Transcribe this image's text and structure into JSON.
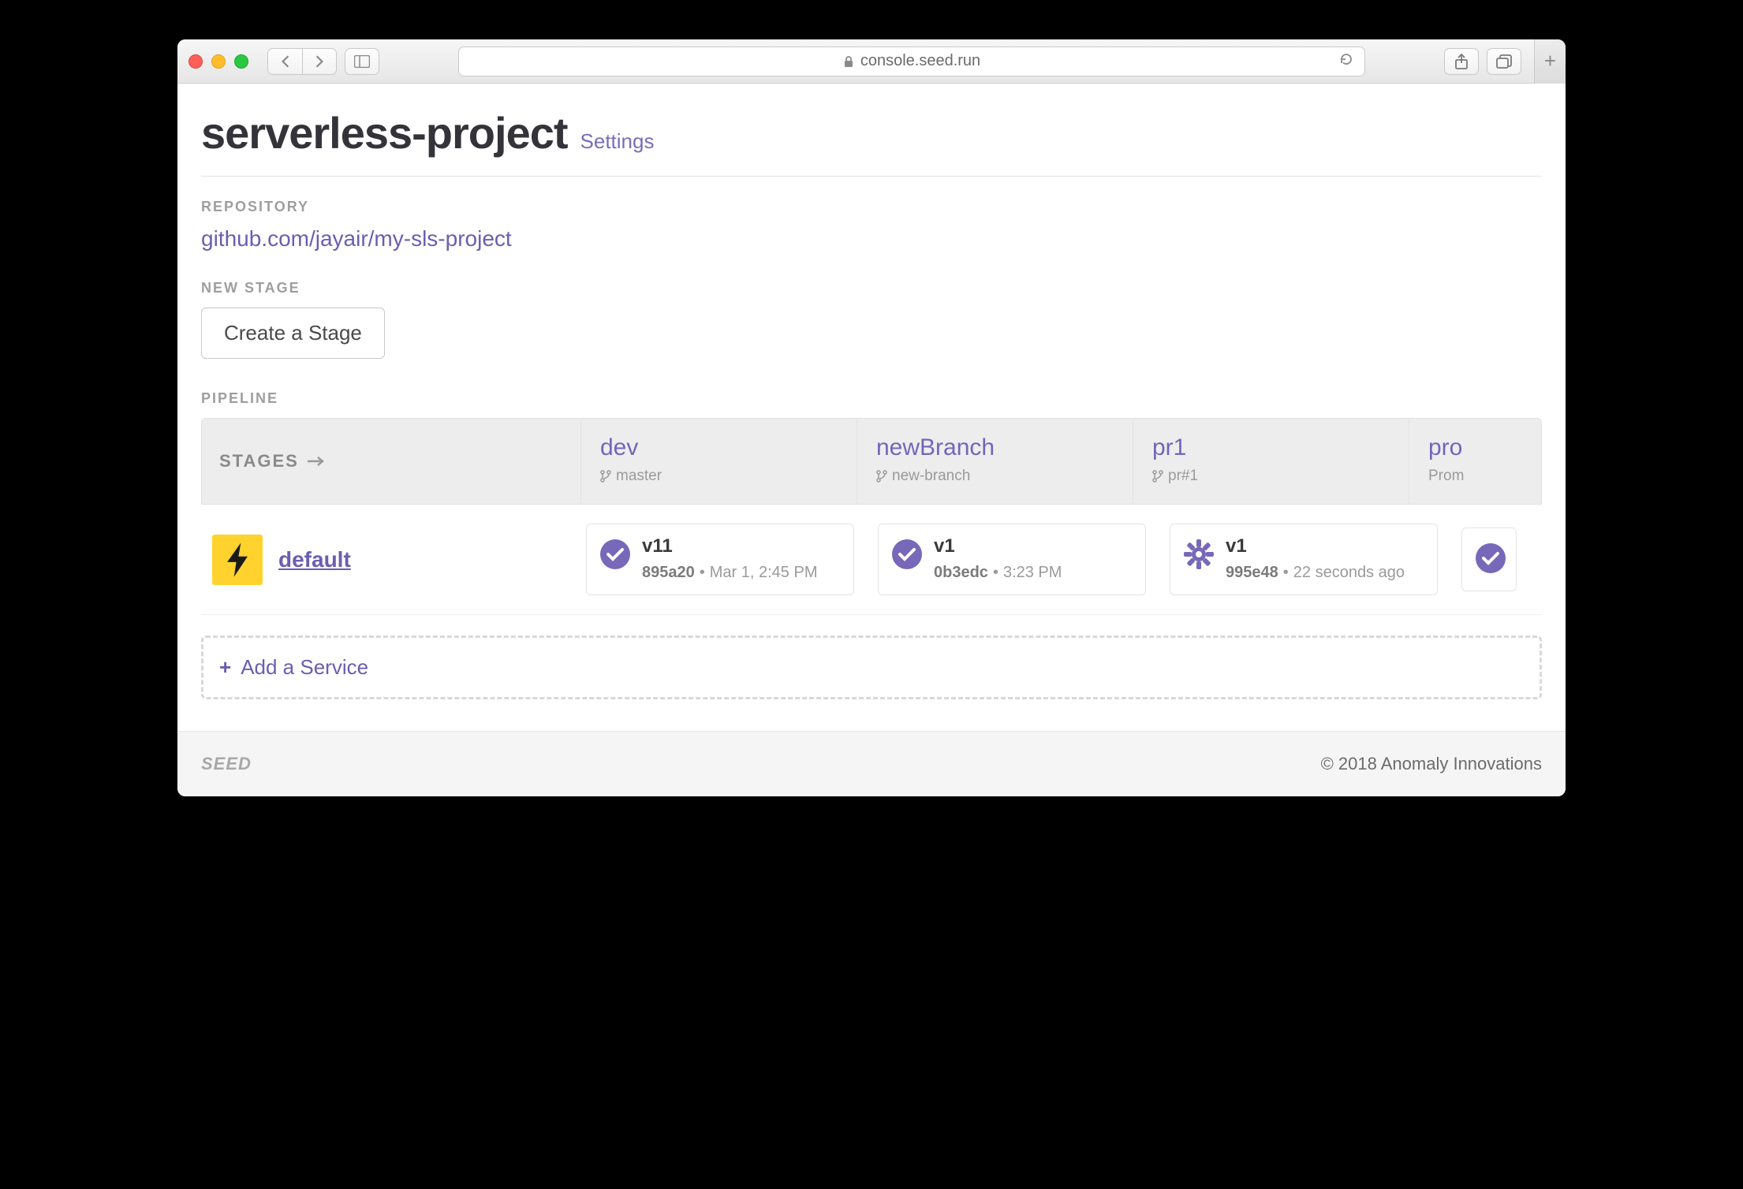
{
  "browser": {
    "url": "console.seed.run"
  },
  "header": {
    "title": "serverless-project",
    "settings_label": "Settings"
  },
  "repository": {
    "label": "REPOSITORY",
    "link": "github.com/jayair/my-sls-project"
  },
  "new_stage": {
    "label": "NEW STAGE",
    "button": "Create a Stage"
  },
  "pipeline": {
    "label": "PIPELINE",
    "stages_header": "STAGES",
    "stages": [
      {
        "name": "dev",
        "branch": "master",
        "sub": ""
      },
      {
        "name": "newBranch",
        "branch": "new-branch",
        "sub": ""
      },
      {
        "name": "pr1",
        "branch": "pr#1",
        "sub": ""
      },
      {
        "name": "pro",
        "branch": "",
        "sub": "Prom"
      }
    ],
    "service": {
      "name": "default",
      "builds": [
        {
          "status": "success",
          "version": "v11",
          "hash": "895a20",
          "time": "Mar 1, 2:45 PM"
        },
        {
          "status": "success",
          "version": "v1",
          "hash": "0b3edc",
          "time": "3:23 PM"
        },
        {
          "status": "building",
          "version": "v1",
          "hash": "995e48",
          "time": "22 seconds ago"
        },
        {
          "status": "success",
          "version": "",
          "hash": "",
          "time": ""
        }
      ]
    },
    "add_service": "Add a Service"
  },
  "footer": {
    "brand": "SEED",
    "copyright": "© 2018 Anomaly Innovations"
  }
}
